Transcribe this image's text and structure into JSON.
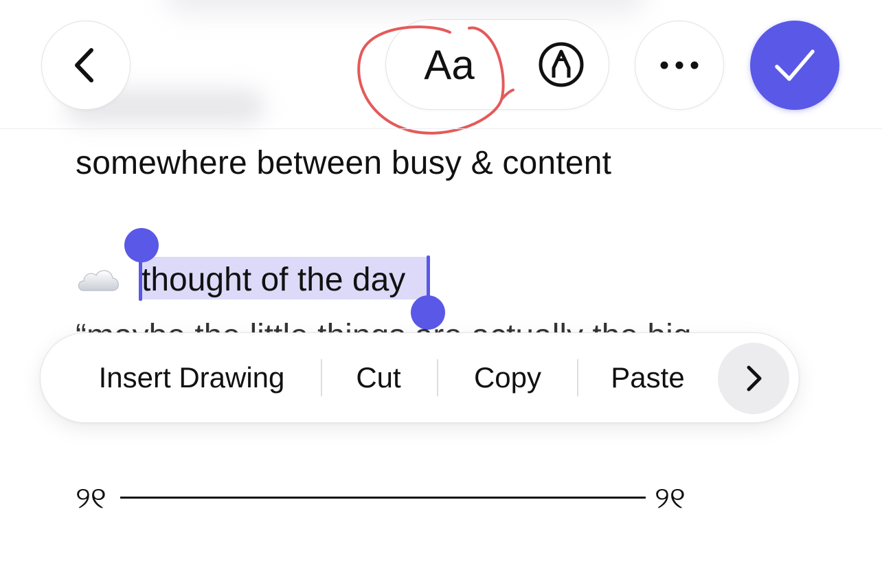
{
  "toolbar": {
    "back_icon": "chevron-left-icon",
    "format_label": "Aa",
    "markup_icon": "markup-pen-icon",
    "more_icon": "ellipsis-icon",
    "done_icon": "checkmark-icon",
    "accent_color": "#5a58e6",
    "annotation_color": "#e45a5a"
  },
  "note": {
    "line1": "somewhere between busy & content",
    "emoji_icon": "cloud-icon",
    "selected_text": "thought of the day",
    "partial_line": "“maybe the little things are actually the big",
    "quote_left": "୨୧",
    "quote_right": "୨୧"
  },
  "context_menu": {
    "items": [
      {
        "label": "Insert Drawing"
      },
      {
        "label": "Cut"
      },
      {
        "label": "Copy"
      },
      {
        "label": "Paste"
      }
    ],
    "next_icon": "chevron-right-icon"
  }
}
